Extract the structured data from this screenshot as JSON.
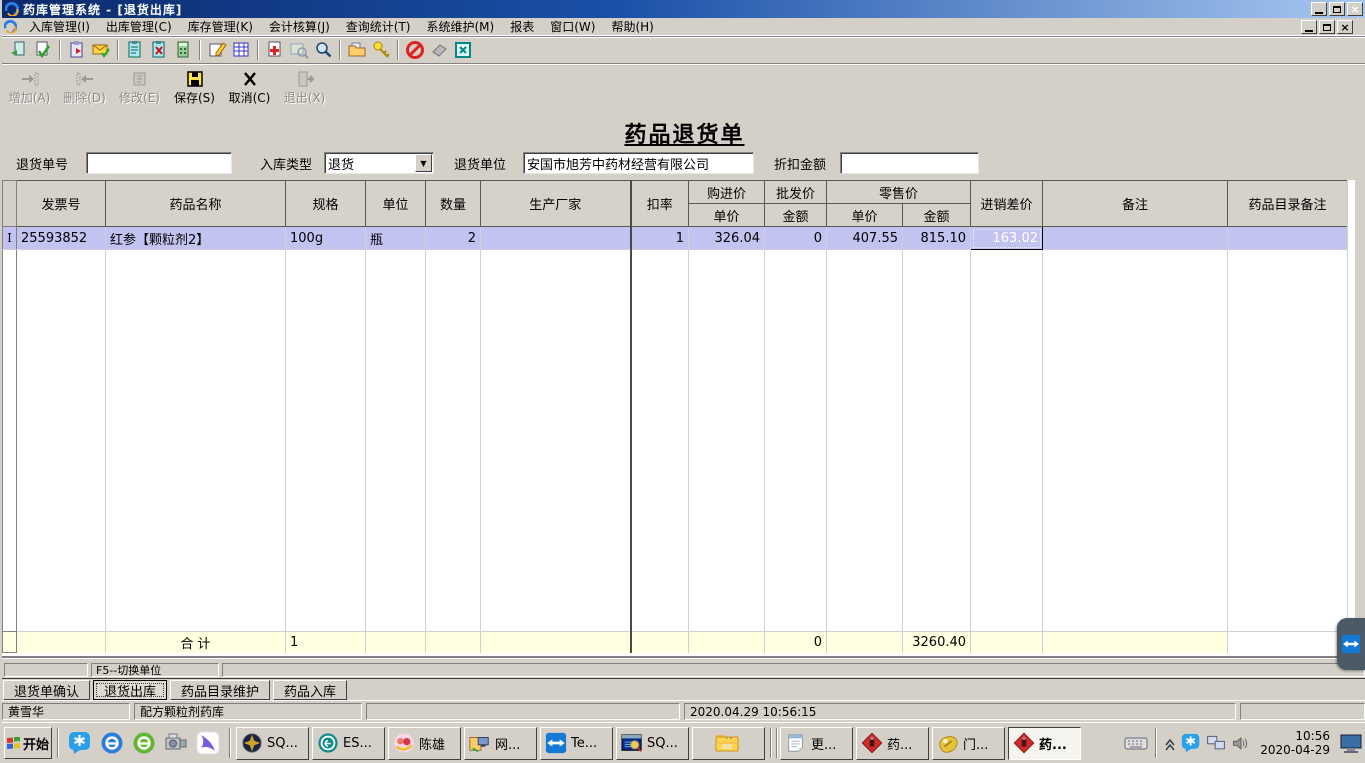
{
  "window": {
    "title": "药库管理系统 - [退货出库]",
    "controls": [
      "minimize-button",
      "restore-button",
      "close-button"
    ]
  },
  "menubar": {
    "items": [
      "入库管理(I)",
      "出库管理(C)",
      "库存管理(K)",
      "会计核算(J)",
      "查询统计(T)",
      "系统维护(M)",
      "报表",
      "窗口(W)",
      "帮助(H)"
    ]
  },
  "toolbar": {
    "icons": [
      "new-document-icon",
      "verify-document-icon",
      "clipboard-in-icon",
      "approve-envelope-icon",
      "clipboard-view-icon",
      "clipboard-cancel-icon",
      "calculator-icon",
      "edit-note-icon",
      "data-table-icon",
      "medical-record-icon",
      "map-search-icon",
      "search-icon",
      "folder-send-icon",
      "key-icon",
      "forbid-icon",
      "eraser-icon",
      "close-window-icon"
    ]
  },
  "edit_toolbar": {
    "buttons": [
      {
        "label": "增加(A)",
        "enabled": false
      },
      {
        "label": "删除(D)",
        "enabled": false
      },
      {
        "label": "修改(E)",
        "enabled": false
      },
      {
        "label": "保存(S)",
        "enabled": true
      },
      {
        "label": "取消(C)",
        "enabled": true
      },
      {
        "label": "退出(X)",
        "enabled": false
      }
    ]
  },
  "form": {
    "title": "药品退货单",
    "return_no_label": "退货单号",
    "return_no_value": "",
    "type_label": "入库类型",
    "type_value": "退货",
    "unit_label": "退货单位",
    "unit_value": "安国市旭芳中药材经营有限公司",
    "discount_label": "折扣金额",
    "discount_value": ""
  },
  "grid": {
    "columns": [
      "发票号",
      "药品名称",
      "规格",
      "单位",
      "数量",
      "生产厂家",
      "扣率",
      "购进价",
      "批发价",
      "零售价",
      "进销差价",
      "备注",
      "药品目录备注"
    ],
    "subcolumns": [
      "单价",
      "金额",
      "单价",
      "金额"
    ],
    "row_marker": "I",
    "row": {
      "invoice": "25593852",
      "name": "红参【颗粒剂2】",
      "spec": "100g",
      "unit": "瓶",
      "qty": "2",
      "maker": "",
      "rate": "1",
      "buy_price": "326.04",
      "wholesale_amount": "0",
      "retail_price": "407.55",
      "retail_amount": "815.10",
      "price_diff": "163.02",
      "note": "",
      "catalog_note": ""
    },
    "total": {
      "label": "合  计",
      "count": "1",
      "wholesale_amount": "0",
      "retail_amount": "3260.40"
    }
  },
  "hint_bar": {
    "f5_hint": "F5--切换单位"
  },
  "tabs": {
    "items": [
      "退货单确认",
      "退货出库",
      "药品目录维护",
      "药品入库"
    ],
    "active": "退货出库"
  },
  "statusbar": {
    "user": "黄雪华",
    "depot": "配方颗粒剂药库",
    "timestamp": "2020.04.29 10:56:15"
  },
  "taskbar": {
    "start_label": "开始",
    "quick_launch": [
      "star-bubble-icon",
      "ie-icon",
      "browser-360-icon",
      "screen-recorder-icon",
      "thunder-icon"
    ],
    "buttons": [
      {
        "label": "SQ...",
        "icon": "compass-icon"
      },
      {
        "label": "ES...",
        "icon": "eset-icon"
      },
      {
        "label": "陈雄",
        "icon": "qq-avatar-icon"
      },
      {
        "label": "网...",
        "icon": "network-places-icon"
      },
      {
        "label": "Te...",
        "icon": "teamviewer-icon"
      },
      {
        "label": "SQ...",
        "icon": "sql-query-icon"
      },
      {
        "label": "",
        "icon": "folder-icon"
      },
      {
        "label": "更...",
        "icon": "notepad-icon"
      },
      {
        "label": "药...",
        "icon": "pharmacy-app-icon"
      },
      {
        "label": "门...",
        "icon": "clinic-app-icon"
      },
      {
        "label": "药...",
        "icon": "pharmacy-app-icon"
      }
    ],
    "tray_icons": [
      "keyboard-icon",
      "collapse-arrow-icon",
      "star-bubble-tray-icon",
      "network-tray-icon",
      "volume-icon"
    ],
    "clock": {
      "time": "10:56",
      "date": "2020-04-29"
    }
  },
  "colors": {
    "titlebar_start": "#0b2a6b",
    "titlebar_end": "#a8c8f0",
    "chrome": "#d4d0c8",
    "row_highlight": "#c3c3f1",
    "total_row": "#ffffe1",
    "teamviewer_blue": "#1479d4"
  }
}
